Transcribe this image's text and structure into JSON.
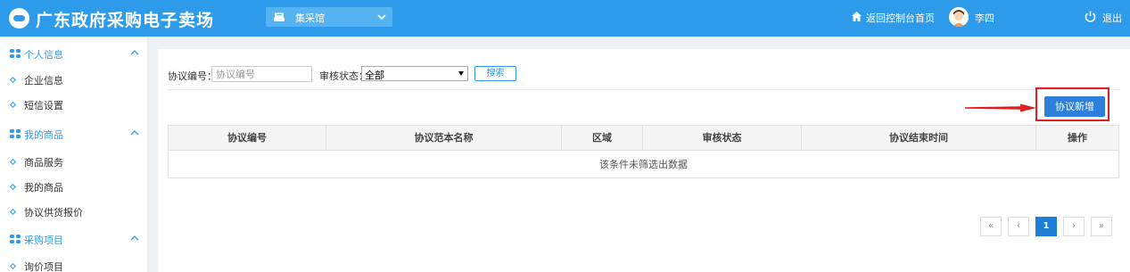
{
  "header": {
    "app_title": "广东政府采购电子卖场",
    "venue": "集采馆",
    "home_link": "返回控制台首页",
    "user_name": "李四",
    "logout": "退出"
  },
  "sidebar": {
    "groups": [
      {
        "label": "个人信息",
        "items": [
          "企业信息",
          "短信设置"
        ]
      },
      {
        "label": "我的商品",
        "items": [
          "商品服务",
          "我的商品",
          "协议供货报价"
        ]
      },
      {
        "label": "采购项目",
        "items": [
          "询价项目"
        ]
      }
    ]
  },
  "filters": {
    "agreement_no_label": "协议编号：",
    "agreement_no_placeholder": "协议编号",
    "agreement_no_value": "",
    "status_label": "审核状态：",
    "status_value": "全部",
    "search_label": "搜索"
  },
  "actions": {
    "add_agreement_label": "协议新增"
  },
  "table": {
    "columns": [
      "协议编号",
      "协议范本名称",
      "区域",
      "审核状态",
      "协议结束时间",
      "操作"
    ],
    "empty_message": "该条件未筛选出数据"
  },
  "pagination": {
    "first": "«",
    "prev": "‹",
    "current": "1",
    "next": "›",
    "last": "»"
  },
  "colors": {
    "primary": "#2d9bea",
    "button_blue": "#2d7fd9",
    "highlight_red": "#e02020"
  }
}
